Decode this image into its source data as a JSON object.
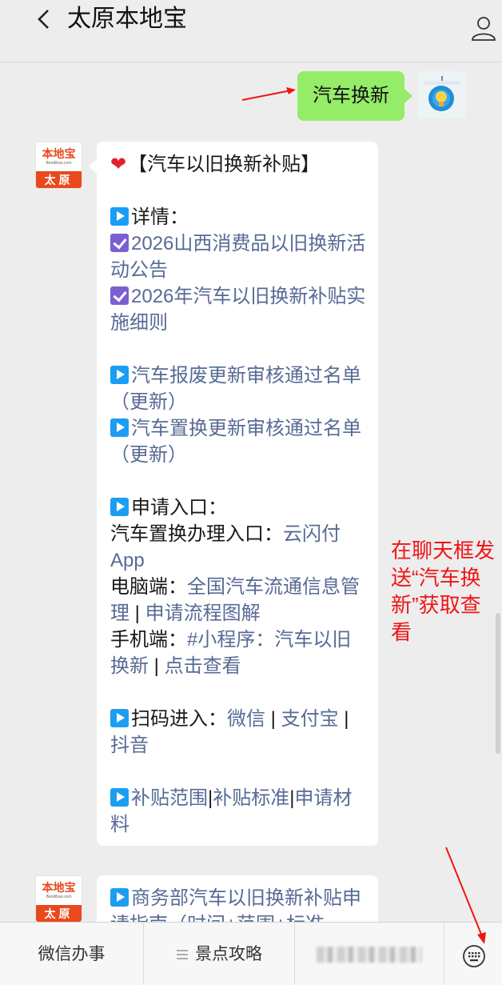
{
  "header": {
    "title": "太原本地宝"
  },
  "outgoing_message": {
    "text": "汽车换新"
  },
  "bot": {
    "avatar_brand": "本地宝",
    "avatar_domain": "Bendibao.com",
    "avatar_city": "太原"
  },
  "reply1": {
    "title": "【汽车以旧换新补贴】",
    "details_label": "详情：",
    "notice_link": "2026山西消费品以旧换新活动公告",
    "rules_link": "2026年汽车以旧换新补贴实施细则",
    "scrap_list_link": "汽车报废更新审核通过名单（更新）",
    "replace_list_link": "汽车置换更新审核通过名单（更新）",
    "apply_entry_label": "申请入口：",
    "replace_entry_label": "汽车置换办理入口：",
    "replace_entry_link": "云闪付App",
    "pc_label": "电脑端：",
    "pc_link": "全国汽车流通信息管理",
    "pc_sep": " | ",
    "pc_flow_link": "申请流程图解",
    "mobile_label": "手机端：",
    "mobile_link": "#小程序：汽车以旧换新",
    "mobile_sep": " | ",
    "mobile_view_link": "点击查看",
    "scan_label": "扫码进入：",
    "scan_wechat": "微信",
    "scan_sep1": " | ",
    "scan_alipay": "支付宝",
    "scan_sep2": " | ",
    "scan_douyin": "抖音",
    "scope_link": "补贴范围",
    "bar1": "|",
    "standard_link": "补贴标准",
    "bar2": "|",
    "material_link": "申请材料"
  },
  "reply2": {
    "text": "商务部汽车以旧换新补贴申请指南（时间+范围+标准"
  },
  "annotation": {
    "text": "在聊天框发送“汽车换新”获取查看",
    "color": "#f01515"
  },
  "footer": {
    "tab1": "微信办事",
    "tab2": "景点攻略"
  },
  "colors": {
    "link": "#576b95",
    "outgoing_bubble": "#95ec69",
    "brand": "#e8491d"
  }
}
